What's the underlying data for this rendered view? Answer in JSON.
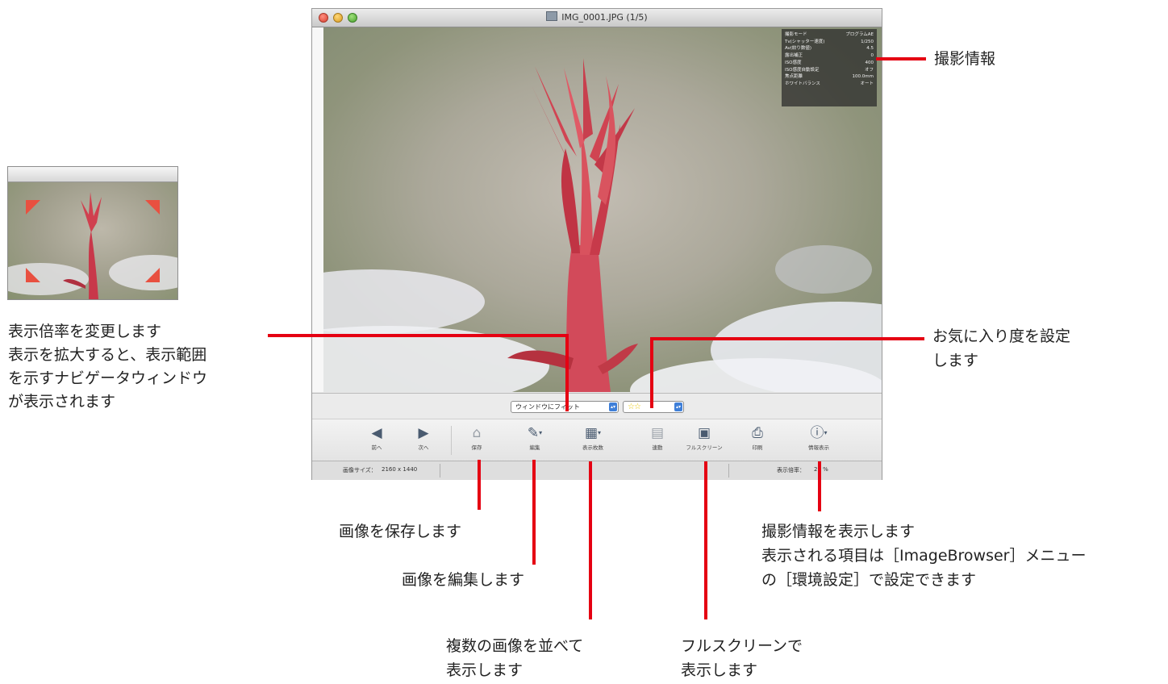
{
  "window": {
    "title": "IMG_0001.JPG (1/5)",
    "shooting_info": [
      {
        "label": "撮影モード",
        "value": "プログラムAE"
      },
      {
        "label": "Tv(シャッター速度)",
        "value": "1/250"
      },
      {
        "label": "Av(絞り数値)",
        "value": "4.5"
      },
      {
        "label": "露出補正",
        "value": "0"
      },
      {
        "label": "ISO感度",
        "value": "400"
      },
      {
        "label": "ISO感度自動設定",
        "value": "オフ"
      },
      {
        "label": "焦点距離",
        "value": "100.0mm"
      },
      {
        "label": "ホワイトバランス",
        "value": "オート"
      }
    ],
    "zoom_select": {
      "value": "ウィンドウにフィット"
    },
    "rating_select": {
      "value": "☆☆"
    },
    "toolbar": {
      "prev": "前へ",
      "next": "次へ",
      "save": "保存",
      "edit": "編集",
      "display_count": "表示枚数",
      "interlock": "連動",
      "fullscreen": "フルスクリーン",
      "print": "印刷",
      "info": "情報表示"
    },
    "status": {
      "size_label": "画像サイズ：",
      "size_value": "2160 x 1440",
      "zoom_label": "表示倍率：",
      "zoom_value": "29 %"
    }
  },
  "icons": {
    "prev": "triangle-left-icon",
    "next": "triangle-right-icon",
    "save": "save-icon",
    "edit": "edit-icon",
    "display_count": "grid-icon",
    "interlock": "link-icon",
    "fullscreen": "monitor-icon",
    "print": "printer-icon",
    "info": "info-icon"
  },
  "annotations": {
    "shooting_info": "撮影情報",
    "zoom": [
      "表示倍率を変更します",
      "表示を拡大すると、表示範囲",
      "を示すナビゲータウィンドウ",
      "が表示されます"
    ],
    "rating": [
      "お気に入り度を設定",
      "します"
    ],
    "save": "画像を保存します",
    "edit": "画像を編集します",
    "display_count": [
      "複数の画像を並べて",
      "表示します"
    ],
    "fullscreen": [
      "フルスクリーンで",
      "表示します"
    ],
    "info": [
      "撮影情報を表示します",
      "表示される項目は［ImageBrowser］メニュー",
      "の［環境設定］で設定できます"
    ]
  },
  "colors": {
    "callout_line": "#e50012",
    "flower": "#c8384a",
    "rating_star": "#e9c600",
    "select_arrow": "#3f7fd8"
  }
}
